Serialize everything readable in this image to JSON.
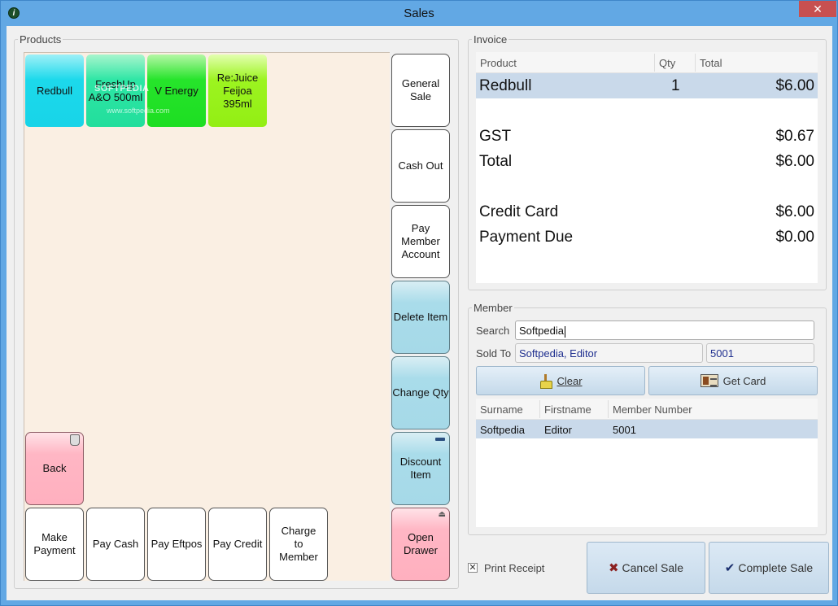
{
  "window": {
    "title": "Sales"
  },
  "products": {
    "legend": "Products",
    "tiles": [
      {
        "label": "Redbull"
      },
      {
        "label": "FreshUp A&O 500ml"
      },
      {
        "label": "V Energy"
      },
      {
        "label": "Re:Juice Feijoa 395ml"
      }
    ],
    "watermark": "SOFTPEDIA",
    "watermark_url": "www.softpedia.com",
    "back_label": "Back",
    "bottom_buttons": [
      "Make Payment",
      "Pay Cash",
      "Pay Eftpos",
      "Pay Credit",
      "Charge to Member"
    ],
    "side_buttons": [
      "General Sale",
      "Cash Out",
      "Pay Member Account",
      "Delete Item",
      "Change Qty",
      "Discount Item",
      "Open Drawer"
    ]
  },
  "invoice": {
    "legend": "Invoice",
    "columns": [
      "Product",
      "Qty",
      "Total"
    ],
    "items": [
      {
        "product": "Redbull",
        "qty": "1",
        "total": "$6.00"
      }
    ],
    "gst_label": "GST",
    "gst_value": "$0.67",
    "total_label": "Total",
    "total_value": "$6.00",
    "credit_label": "Credit Card",
    "credit_value": "$6.00",
    "due_label": "Payment Due",
    "due_value": "$0.00"
  },
  "member": {
    "legend": "Member",
    "search_label": "Search",
    "search_value": "Softpedia",
    "sold_to_label": "Sold To",
    "sold_to_name": "Softpedia, Editor",
    "sold_to_number": "5001",
    "clear_label": "Clear",
    "get_card_label": "Get Card",
    "columns": [
      "Surname",
      "Firstname",
      "Member Number"
    ],
    "rows": [
      {
        "surname": "Softpedia",
        "firstname": "Editor",
        "number": "5001"
      }
    ]
  },
  "footer": {
    "print_receipt_label": "Print Receipt",
    "cancel_label": "Cancel Sale",
    "complete_label": "Complete Sale"
  },
  "colors": {
    "title_bar": "#62a8e4",
    "products_bg": "#faefe3",
    "selected_row": "#c9d9ea",
    "close_button": "#c75050"
  }
}
